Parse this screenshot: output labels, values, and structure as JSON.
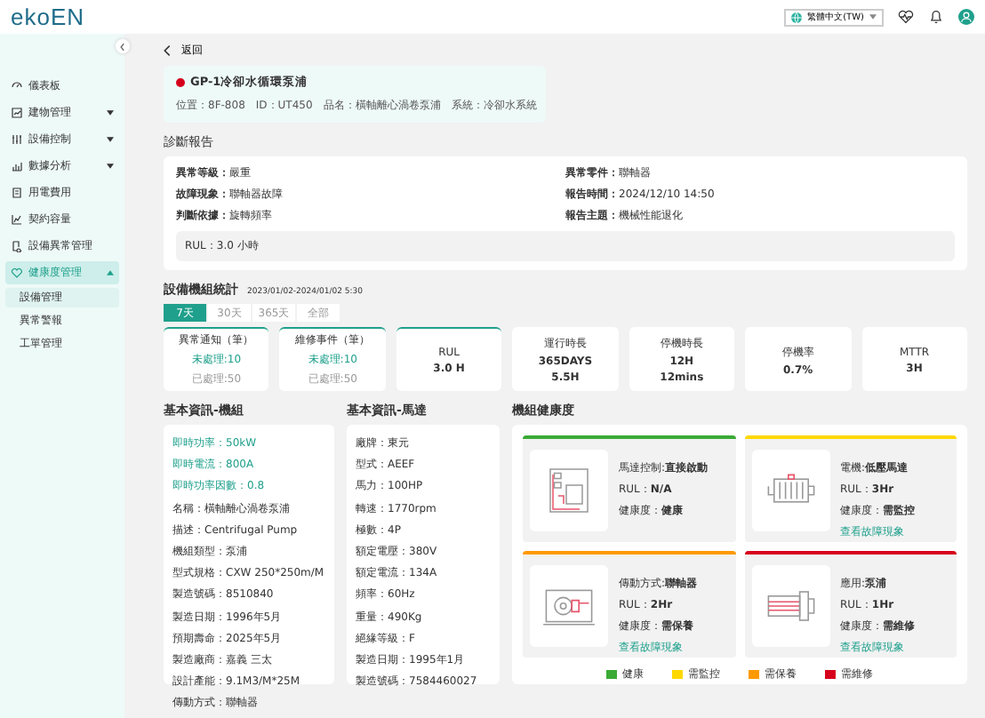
{
  "header": {
    "logo": "ekoEN",
    "language": "繁體中文(TW)"
  },
  "sidebar": {
    "items": [
      {
        "label": "儀表板",
        "selected": false
      },
      {
        "label": "建物管理",
        "selected": false,
        "expanded": false
      },
      {
        "label": "設備控制",
        "selected": false,
        "expanded": false
      },
      {
        "label": "數據分析",
        "selected": false,
        "expanded": false
      },
      {
        "label": "用電費用",
        "selected": false
      },
      {
        "label": "契約容量",
        "selected": false
      },
      {
        "label": "設備異常管理",
        "selected": false
      },
      {
        "label": "健康度管理",
        "selected": true,
        "expanded": true,
        "children": [
          {
            "label": "設備管理",
            "selected": true
          },
          {
            "label": "異常警報",
            "selected": false
          },
          {
            "label": "工單管理",
            "selected": false
          }
        ]
      }
    ]
  },
  "back": "返回",
  "device": {
    "alarm": true,
    "name": "GP-1冷卻水循環泵浦",
    "meta": [
      "位置：8F-808",
      "ID：UT450",
      "品名：橫軸離心渦卷泵浦",
      "系統：冷卻水系統"
    ]
  },
  "report": {
    "title": "診斷報告",
    "fields": [
      "**異常等級：**嚴重",
      "**異常零件：**聯軸器",
      "**故障現象：**聯軸器故障",
      "**報告時間：**2024/12/10 14:50",
      "**判斷依據：**旋轉頻率",
      "**報告主題：**機械性能退化"
    ],
    "note": "RUL：3.0 小時"
  },
  "stats": {
    "title": "設備機組統計",
    "range": "2023/01/02-2024/01/02 5:30",
    "tabs": [
      {
        "label": "7天",
        "selected": true
      },
      {
        "label": "30天",
        "selected": false
      },
      {
        "label": "365天",
        "selected": false
      },
      {
        "label": "全部",
        "selected": false
      }
    ],
    "cards": [
      {
        "kind": "counts",
        "title": "異常通知（筆）",
        "accent": true,
        "pending": "未處理:10",
        "done": "已處理:50"
      },
      {
        "kind": "counts",
        "title": "維修事件（筆）",
        "accent": true,
        "pending": "未處理:10",
        "done": "已處理:50"
      },
      {
        "kind": "metric",
        "title": "RUL",
        "accent": true,
        "values": [
          "3.0 H"
        ]
      },
      {
        "kind": "metric",
        "title": "運行時長",
        "accent": false,
        "values": [
          "365DAYS",
          "5.5H"
        ]
      },
      {
        "kind": "metric",
        "title": "停機時長",
        "accent": false,
        "values": [
          "12H",
          "12mins"
        ]
      },
      {
        "kind": "metric",
        "title": "停機率",
        "accent": false,
        "values": [
          "0.7%"
        ]
      },
      {
        "kind": "metric",
        "title": "MTTR",
        "accent": false,
        "values": [
          "3H"
        ]
      }
    ]
  },
  "unit_info": {
    "title": "基本資訊-機組",
    "rows": [
      {
        "text": "即時功率：50kW",
        "highlight": true
      },
      {
        "text": "即時電流：800A",
        "highlight": true
      },
      {
        "text": "即時功率因數：0.8",
        "highlight": true
      },
      {
        "text": "名稱：橫軸離心渦卷泵浦",
        "highlight": false
      },
      {
        "text": "描述：Centrifugal Pump",
        "highlight": false
      },
      {
        "text": "機組類型：泵浦",
        "highlight": false
      },
      {
        "text": "型式規格：CXW 250*250m/M",
        "highlight": false
      },
      {
        "text": "製造號碼：8510840",
        "highlight": false
      },
      {
        "text": "製造日期：1996年5月",
        "highlight": false
      },
      {
        "text": "預期壽命：2025年5月",
        "highlight": false
      },
      {
        "text": "製造廠商：嘉義 三太",
        "highlight": false
      },
      {
        "text": "設計產能：9.1M3/M*25M",
        "highlight": false
      },
      {
        "text": "傳動方式：聯軸器",
        "highlight": false
      }
    ]
  },
  "motor_info": {
    "title": "基本資訊-馬達",
    "rows": [
      "廠牌：東元",
      "型式：AEEF",
      "馬力：100HP",
      "轉速：1770rpm",
      "極數：4P",
      "額定電壓：380V",
      "額定電流：134A",
      "頻率：60Hz",
      "重量：490Kg",
      "絕緣等級：F",
      "製造日期：1995年1月",
      "製造號碼：7584460027"
    ]
  },
  "health": {
    "title": "機組健康度",
    "cards": [
      {
        "kind": "control-panel",
        "color": "#3aaa35",
        "lines": [
          "馬達控制:**直接啟動**",
          "RUL：**N/A**",
          "健康度：**健康**"
        ]
      },
      {
        "kind": "motor",
        "color": "#ffd800",
        "lines": [
          "電機:**低壓馬達**",
          "RUL：**3Hr**",
          "健康度：**需監控**"
        ],
        "link": "查看故障現象"
      },
      {
        "kind": "gearbox",
        "color": "#ff9900",
        "lines": [
          "傳動方式:**聯軸器**",
          "RUL：**2Hr**",
          "健康度：**需保養**"
        ],
        "link": "查看故障現象"
      },
      {
        "kind": "pump",
        "color": "#d6001c",
        "lines": [
          "應用:**泵浦**",
          "RUL：**1Hr**",
          "健康度：**需維修**"
        ],
        "link": "查看故障現象"
      }
    ],
    "legend": [
      {
        "label": "健康",
        "color": "#3aaa35"
      },
      {
        "label": "需監控",
        "color": "#ffd800"
      },
      {
        "label": "需保養",
        "color": "#ff9900"
      },
      {
        "label": "需維修",
        "color": "#d6001c"
      }
    ]
  }
}
